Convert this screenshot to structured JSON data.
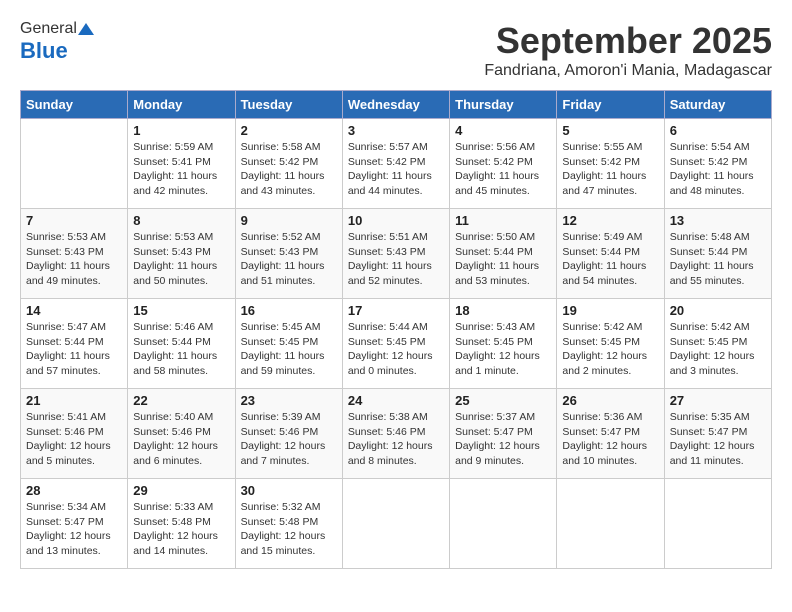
{
  "header": {
    "logo_general": "General",
    "logo_blue": "Blue",
    "month": "September 2025",
    "location": "Fandriana, Amoron'i Mania, Madagascar"
  },
  "days_of_week": [
    "Sunday",
    "Monday",
    "Tuesday",
    "Wednesday",
    "Thursday",
    "Friday",
    "Saturday"
  ],
  "weeks": [
    [
      {
        "day": "",
        "info": ""
      },
      {
        "day": "1",
        "info": "Sunrise: 5:59 AM\nSunset: 5:41 PM\nDaylight: 11 hours\nand 42 minutes."
      },
      {
        "day": "2",
        "info": "Sunrise: 5:58 AM\nSunset: 5:42 PM\nDaylight: 11 hours\nand 43 minutes."
      },
      {
        "day": "3",
        "info": "Sunrise: 5:57 AM\nSunset: 5:42 PM\nDaylight: 11 hours\nand 44 minutes."
      },
      {
        "day": "4",
        "info": "Sunrise: 5:56 AM\nSunset: 5:42 PM\nDaylight: 11 hours\nand 45 minutes."
      },
      {
        "day": "5",
        "info": "Sunrise: 5:55 AM\nSunset: 5:42 PM\nDaylight: 11 hours\nand 47 minutes."
      },
      {
        "day": "6",
        "info": "Sunrise: 5:54 AM\nSunset: 5:42 PM\nDaylight: 11 hours\nand 48 minutes."
      }
    ],
    [
      {
        "day": "7",
        "info": "Sunrise: 5:53 AM\nSunset: 5:43 PM\nDaylight: 11 hours\nand 49 minutes."
      },
      {
        "day": "8",
        "info": "Sunrise: 5:53 AM\nSunset: 5:43 PM\nDaylight: 11 hours\nand 50 minutes."
      },
      {
        "day": "9",
        "info": "Sunrise: 5:52 AM\nSunset: 5:43 PM\nDaylight: 11 hours\nand 51 minutes."
      },
      {
        "day": "10",
        "info": "Sunrise: 5:51 AM\nSunset: 5:43 PM\nDaylight: 11 hours\nand 52 minutes."
      },
      {
        "day": "11",
        "info": "Sunrise: 5:50 AM\nSunset: 5:44 PM\nDaylight: 11 hours\nand 53 minutes."
      },
      {
        "day": "12",
        "info": "Sunrise: 5:49 AM\nSunset: 5:44 PM\nDaylight: 11 hours\nand 54 minutes."
      },
      {
        "day": "13",
        "info": "Sunrise: 5:48 AM\nSunset: 5:44 PM\nDaylight: 11 hours\nand 55 minutes."
      }
    ],
    [
      {
        "day": "14",
        "info": "Sunrise: 5:47 AM\nSunset: 5:44 PM\nDaylight: 11 hours\nand 57 minutes."
      },
      {
        "day": "15",
        "info": "Sunrise: 5:46 AM\nSunset: 5:44 PM\nDaylight: 11 hours\nand 58 minutes."
      },
      {
        "day": "16",
        "info": "Sunrise: 5:45 AM\nSunset: 5:45 PM\nDaylight: 11 hours\nand 59 minutes."
      },
      {
        "day": "17",
        "info": "Sunrise: 5:44 AM\nSunset: 5:45 PM\nDaylight: 12 hours\nand 0 minutes."
      },
      {
        "day": "18",
        "info": "Sunrise: 5:43 AM\nSunset: 5:45 PM\nDaylight: 12 hours\nand 1 minute."
      },
      {
        "day": "19",
        "info": "Sunrise: 5:42 AM\nSunset: 5:45 PM\nDaylight: 12 hours\nand 2 minutes."
      },
      {
        "day": "20",
        "info": "Sunrise: 5:42 AM\nSunset: 5:45 PM\nDaylight: 12 hours\nand 3 minutes."
      }
    ],
    [
      {
        "day": "21",
        "info": "Sunrise: 5:41 AM\nSunset: 5:46 PM\nDaylight: 12 hours\nand 5 minutes."
      },
      {
        "day": "22",
        "info": "Sunrise: 5:40 AM\nSunset: 5:46 PM\nDaylight: 12 hours\nand 6 minutes."
      },
      {
        "day": "23",
        "info": "Sunrise: 5:39 AM\nSunset: 5:46 PM\nDaylight: 12 hours\nand 7 minutes."
      },
      {
        "day": "24",
        "info": "Sunrise: 5:38 AM\nSunset: 5:46 PM\nDaylight: 12 hours\nand 8 minutes."
      },
      {
        "day": "25",
        "info": "Sunrise: 5:37 AM\nSunset: 5:47 PM\nDaylight: 12 hours\nand 9 minutes."
      },
      {
        "day": "26",
        "info": "Sunrise: 5:36 AM\nSunset: 5:47 PM\nDaylight: 12 hours\nand 10 minutes."
      },
      {
        "day": "27",
        "info": "Sunrise: 5:35 AM\nSunset: 5:47 PM\nDaylight: 12 hours\nand 11 minutes."
      }
    ],
    [
      {
        "day": "28",
        "info": "Sunrise: 5:34 AM\nSunset: 5:47 PM\nDaylight: 12 hours\nand 13 minutes."
      },
      {
        "day": "29",
        "info": "Sunrise: 5:33 AM\nSunset: 5:48 PM\nDaylight: 12 hours\nand 14 minutes."
      },
      {
        "day": "30",
        "info": "Sunrise: 5:32 AM\nSunset: 5:48 PM\nDaylight: 12 hours\nand 15 minutes."
      },
      {
        "day": "",
        "info": ""
      },
      {
        "day": "",
        "info": ""
      },
      {
        "day": "",
        "info": ""
      },
      {
        "day": "",
        "info": ""
      }
    ]
  ]
}
